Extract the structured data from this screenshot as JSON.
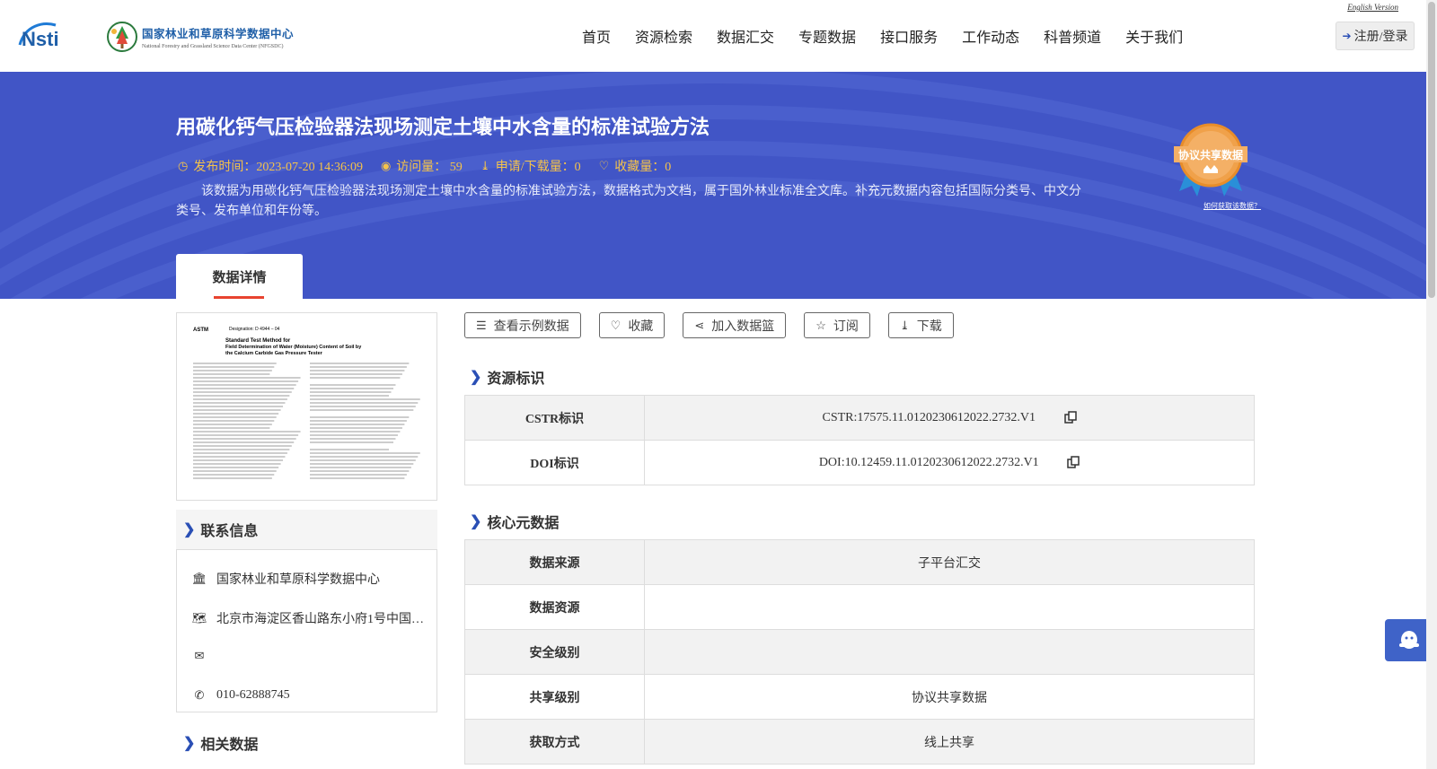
{
  "header": {
    "logo_text": "Nsti",
    "center_name_cn": "国家林业和草原科学数据中心",
    "center_name_en": "National Forestry and Grassland Science Data Center (NFGSDC)",
    "english_link": "English Version",
    "nav": [
      "首页",
      "资源检索",
      "数据汇交",
      "专题数据",
      "接口服务",
      "工作动态",
      "科普频道",
      "关于我们"
    ],
    "login_label": "注册/登录"
  },
  "banner": {
    "title": "用碳化钙气压检验器法现场测定土壤中水含量的标准试验方法",
    "publish": "发布时间：2023-07-20 14:36:09",
    "visits": "访问量： 59",
    "downloads": "申请/下载量：0",
    "favorites": "收藏量：0",
    "description": "该数据为用碳化钙气压检验器法现场测定土壤中水含量的标准试验方法，数据格式为文档，属于国外林业标准全文库。补充元数据内容包括国际分类号、中文分类号、发布单位和年份等。",
    "badge_text": "协议共享数据",
    "badge_link": "如何获取该数据？",
    "tab_label": "数据详情"
  },
  "actions": [
    "查看示例数据",
    "收藏",
    "加入数据篮",
    "订阅",
    "下载"
  ],
  "contact": {
    "heading": "联系信息",
    "org": "国家林业和草原科学数据中心",
    "address": "北京市海淀区香山路东小府1号中国…",
    "email": "",
    "phone": "010-62888745"
  },
  "related": {
    "heading": "相关数据"
  },
  "resource_id": {
    "heading": "资源标识",
    "rows": [
      {
        "key": "CSTR标识",
        "value": "CSTR:17575.11.0120230612022.2732.V1"
      },
      {
        "key": "DOI标识",
        "value": "DOI:10.12459.11.0120230612022.2732.V1"
      }
    ]
  },
  "core_metadata": {
    "heading": "核心元数据",
    "rows": [
      {
        "key": "数据来源",
        "value": "子平台汇交"
      },
      {
        "key": "数据资源",
        "value": ""
      },
      {
        "key": "安全级别",
        "value": ""
      },
      {
        "key": "共享级别",
        "value": "协议共享数据"
      },
      {
        "key": "获取方式",
        "value": "线上共享"
      }
    ]
  },
  "document_preview": {
    "designation": "Designation: D 4944 – 04",
    "title_line_1": "Standard Test Method for",
    "title_line_2": "Field Determination of Water (Moisture) Content of Soil by",
    "title_line_3": "the Calcium Carbide Gas Pressure Tester"
  },
  "colors": {
    "banner": "#4155c6",
    "accent": "#f5c34a",
    "tab_underline": "#e8432f",
    "icon_blue": "#2a4fb5"
  }
}
